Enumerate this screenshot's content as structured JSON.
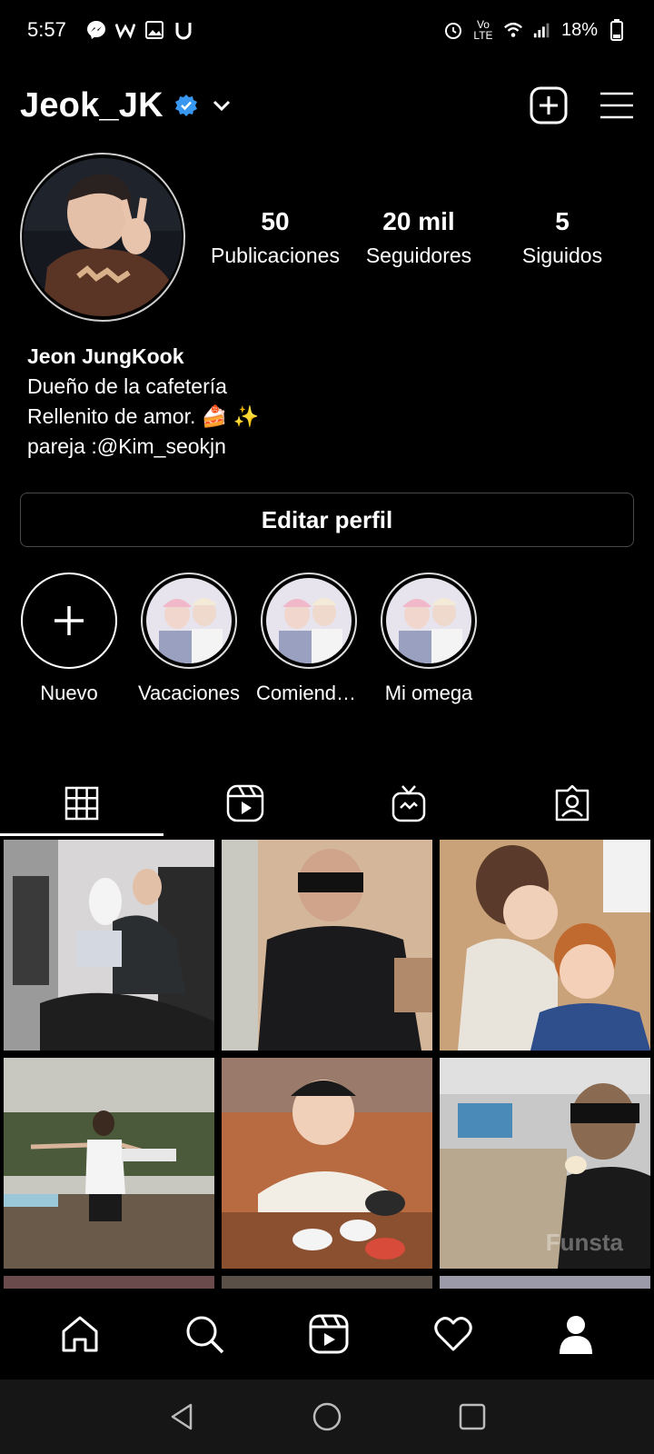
{
  "status_bar": {
    "time": "5:57",
    "network": "Vo LTE",
    "battery": "18%"
  },
  "header": {
    "username": "Jeok_JK"
  },
  "stats": [
    {
      "value": "50",
      "label": "Publicaciones"
    },
    {
      "value": "20 mil",
      "label": "Seguidores"
    },
    {
      "value": "5",
      "label": "Siguidos"
    }
  ],
  "bio": {
    "name": "Jeon JungKook",
    "line1": "Dueño de la cafetería",
    "line2": "Rellenito de amor. 🍰 ✨",
    "line3": "pareja :@Kim_seokjn"
  },
  "edit_profile_label": "Editar perfil",
  "highlights": [
    {
      "label": "Nuevo"
    },
    {
      "label": "Vacaciones"
    },
    {
      "label": "Comiendo..."
    },
    {
      "label": "Mi omega"
    }
  ],
  "watermark": "Funsta",
  "colors": {
    "background": "#000000",
    "verified": "#3897f0",
    "text": "#ffffff"
  }
}
